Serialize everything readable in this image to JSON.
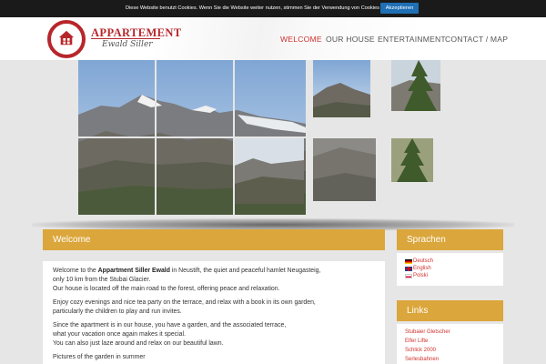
{
  "cookie": {
    "text": "Diese Website benutzt Cookies. Wenn Sie die Website weiter nutzen, stimmen Sie der Verwendung von Cookies zu.",
    "accept_label": "Akzeptieren"
  },
  "logo": {
    "title": "APPARTEMENT",
    "subtitle": "Ewald Siller"
  },
  "nav": {
    "items": [
      {
        "label": "WELCOME",
        "active": true
      },
      {
        "label": "OUR HOUSE",
        "active": false
      },
      {
        "label": "ENTERTAINMENT",
        "active": false
      },
      {
        "label": "CONTACT / MAP",
        "active": false
      }
    ]
  },
  "main": {
    "heading": "Welcome",
    "p1_a": "Welcome to the ",
    "p1_b": "Appartment Siller Ewald",
    "p1_c": " in Neustift, the quiet and peaceful hamlet Neugasteig,",
    "p1_d": "only 10 km from the Stubai Glacier.",
    "p1_e": "Our house is located off the main road to the forest, offering peace and relaxation.",
    "p2_a": "Enjoy cozy evenings and nice tea party on the terrace, and relax with a book in its own garden,",
    "p2_b": "particularly the children to play and run invites.",
    "p3_a": "Since the apartment is in our house, you have a garden, and the associated terrace,",
    "p3_b": "what your vacation once again makes it special.",
    "p3_c": "You can also just laze around and relax on our beautiful lawn.",
    "p4": "Pictures of the garden in summer"
  },
  "sidebar": {
    "languages_heading": "Sprachen",
    "languages": [
      "Deutsch",
      "English",
      "Polski"
    ],
    "links_heading": "Links",
    "links": [
      "Stubaier Gletscher",
      "Elfer Lifte",
      "Schlick 2000",
      "Serlesbahnen"
    ]
  },
  "colors": {
    "accent": "#dba63b",
    "brand_red": "#b7262b",
    "active_nav": "#d0312d"
  }
}
